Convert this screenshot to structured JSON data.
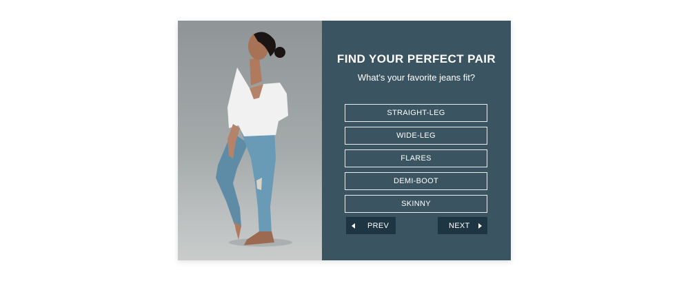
{
  "quiz": {
    "title": "FIND YOUR PERFECT PAIR",
    "question": "What’s your favorite jeans fit?",
    "options": [
      {
        "label": "STRAIGHT-LEG"
      },
      {
        "label": "WIDE-LEG"
      },
      {
        "label": "FLARES"
      },
      {
        "label": "DEMI-BOOT"
      },
      {
        "label": "SKINNY"
      }
    ],
    "prev_label": "PREV",
    "next_label": "NEXT"
  },
  "colors": {
    "panel": "#3b5461",
    "button": "#1e3644",
    "photo_background": "#a5aaab"
  },
  "icons": {
    "prev": "triangle-left-icon",
    "next": "triangle-right-icon"
  }
}
